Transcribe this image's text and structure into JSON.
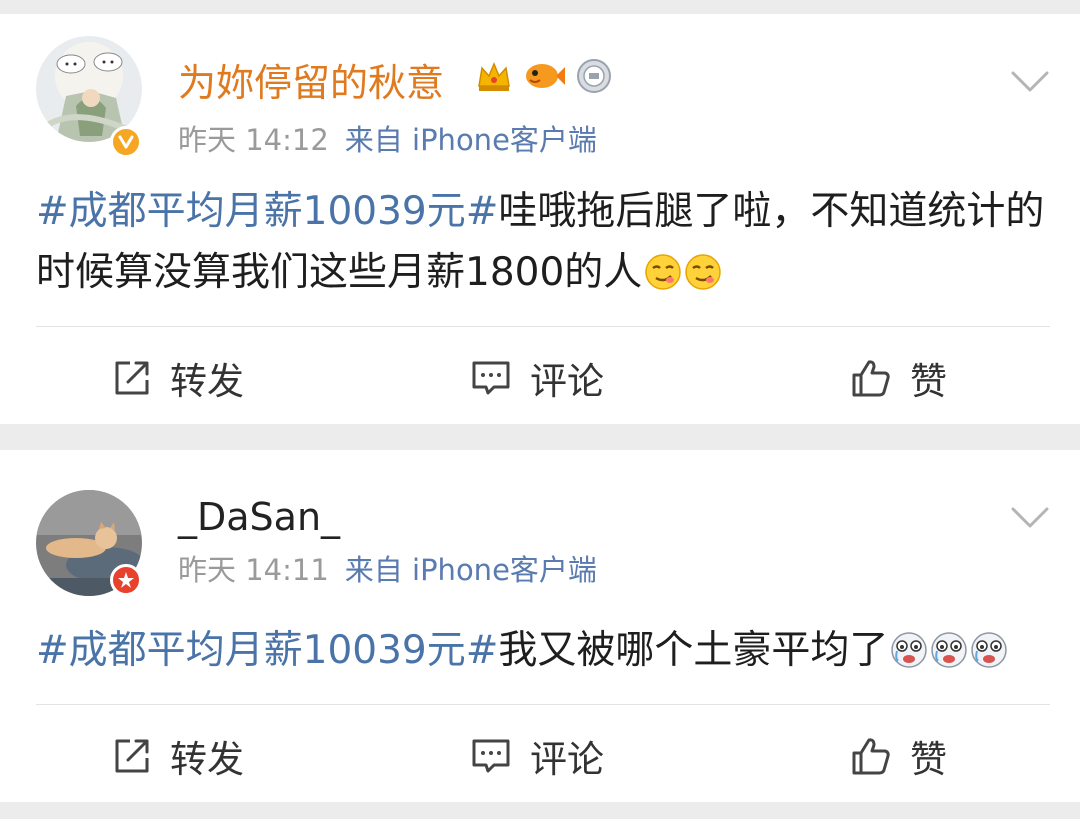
{
  "posts": [
    {
      "username": "为妳停留的秋意",
      "time": "昨天 14:12",
      "source": "来自 iPhone客户端",
      "hashtag": "#成都平均月薪10039元#",
      "text": "哇哦拖后腿了啦，不知道统计的时候算没算我们这些月薪1800的人",
      "emoji_count": 2,
      "actions": {
        "repost": "转发",
        "comment": "评论",
        "like": "赞"
      }
    },
    {
      "username": "_DaSan_",
      "time": "昨天 14:11",
      "source": "来自 iPhone客户端",
      "hashtag": "#成都平均月薪10039元#",
      "text": "我又被哪个土豪平均了",
      "emoji_count": 3,
      "actions": {
        "repost": "转发",
        "comment": "评论",
        "like": "赞"
      }
    }
  ],
  "colors": {
    "hashtag": "#4a74a8",
    "username_highlight": "#e07a1f",
    "meta": "#9a9a9a",
    "verified_badge": "#f5a623",
    "star_badge": "#e8412c"
  }
}
